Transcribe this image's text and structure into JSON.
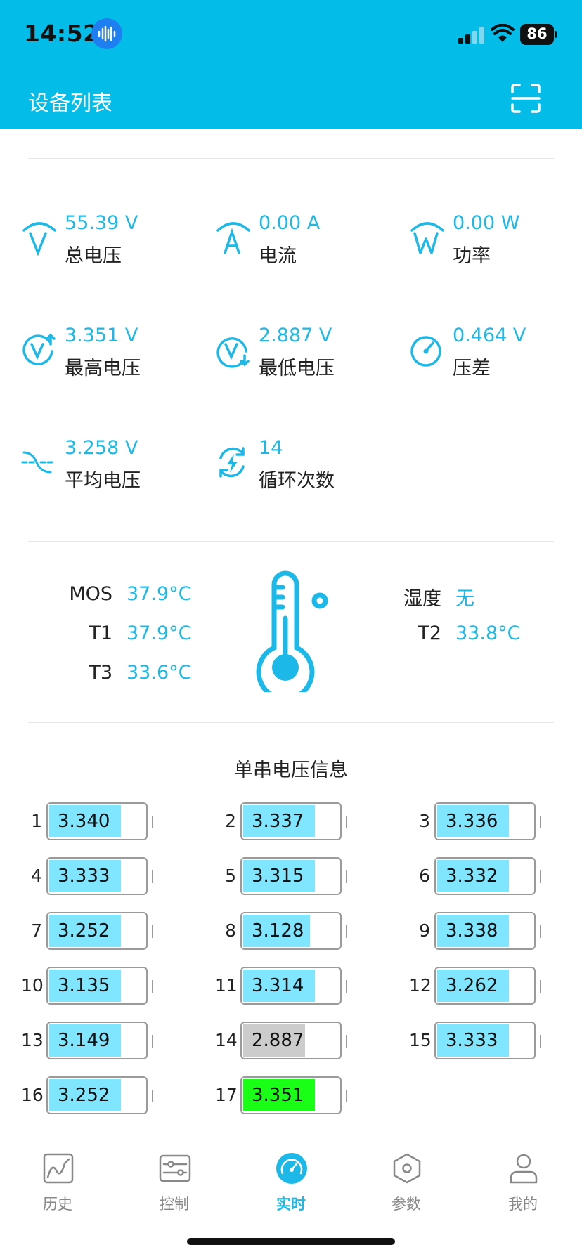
{
  "status": {
    "time": "14:52",
    "battery": "86"
  },
  "header": {
    "title": "设备列表"
  },
  "metrics": [
    {
      "value": "55.39 V",
      "label": "总电压",
      "icon": "voltage-icon"
    },
    {
      "value": "0.00 A",
      "label": "电流",
      "icon": "current-icon"
    },
    {
      "value": "0.00 W",
      "label": "功率",
      "icon": "power-icon"
    },
    {
      "value": "3.351 V",
      "label": "最高电压",
      "icon": "max-voltage-icon"
    },
    {
      "value": "2.887 V",
      "label": "最低电压",
      "icon": "min-voltage-icon"
    },
    {
      "value": "0.464 V",
      "label": "压差",
      "icon": "gauge-icon"
    },
    {
      "value": "3.258 V",
      "label": "平均电压",
      "icon": "average-wave-icon"
    },
    {
      "value": "14",
      "label": "循环次数",
      "icon": "cycle-icon"
    }
  ],
  "temperature": {
    "mos_label": "MOS",
    "mos_value": "37.9°C",
    "t1_label": "T1",
    "t1_value": "37.9°C",
    "t3_label": "T3",
    "t3_value": "33.6°C",
    "humidity_label": "湿度",
    "humidity_value": "无",
    "t2_label": "T2",
    "t2_value": "33.8°C"
  },
  "cells": {
    "title": "单串电压信息",
    "items": [
      {
        "num": "1",
        "value": "3.340",
        "level": 0.75,
        "state": "normal"
      },
      {
        "num": "2",
        "value": "3.337",
        "level": 0.75,
        "state": "normal"
      },
      {
        "num": "3",
        "value": "3.336",
        "level": 0.75,
        "state": "normal"
      },
      {
        "num": "4",
        "value": "3.333",
        "level": 0.75,
        "state": "normal"
      },
      {
        "num": "5",
        "value": "3.315",
        "level": 0.75,
        "state": "normal"
      },
      {
        "num": "6",
        "value": "3.332",
        "level": 0.75,
        "state": "normal"
      },
      {
        "num": "7",
        "value": "3.252",
        "level": 0.75,
        "state": "normal"
      },
      {
        "num": "8",
        "value": "3.128",
        "level": 0.7,
        "state": "normal"
      },
      {
        "num": "9",
        "value": "3.338",
        "level": 0.75,
        "state": "normal"
      },
      {
        "num": "10",
        "value": "3.135",
        "level": 0.75,
        "state": "normal"
      },
      {
        "num": "11",
        "value": "3.314",
        "level": 0.75,
        "state": "normal"
      },
      {
        "num": "12",
        "value": "3.262",
        "level": 0.75,
        "state": "normal"
      },
      {
        "num": "13",
        "value": "3.149",
        "level": 0.75,
        "state": "normal"
      },
      {
        "num": "14",
        "value": "2.887",
        "level": 0.65,
        "state": "min"
      },
      {
        "num": "15",
        "value": "3.333",
        "level": 0.75,
        "state": "normal"
      },
      {
        "num": "16",
        "value": "3.252",
        "level": 0.75,
        "state": "normal"
      },
      {
        "num": "17",
        "value": "3.351",
        "level": 0.75,
        "state": "max"
      }
    ]
  },
  "colors": {
    "accent": "#03bde8",
    "value_text": "#1cb8e8",
    "cell_fill": "#80e6ff",
    "cell_min": "#cccccc",
    "cell_max": "#1aff16"
  },
  "tabs": [
    {
      "label": "历史",
      "icon": "history-chart-icon",
      "active": false
    },
    {
      "label": "控制",
      "icon": "control-sliders-icon",
      "active": false
    },
    {
      "label": "实时",
      "icon": "realtime-gauge-icon",
      "active": true
    },
    {
      "label": "参数",
      "icon": "parameter-hex-icon",
      "active": false
    },
    {
      "label": "我的",
      "icon": "profile-icon",
      "active": false
    }
  ]
}
